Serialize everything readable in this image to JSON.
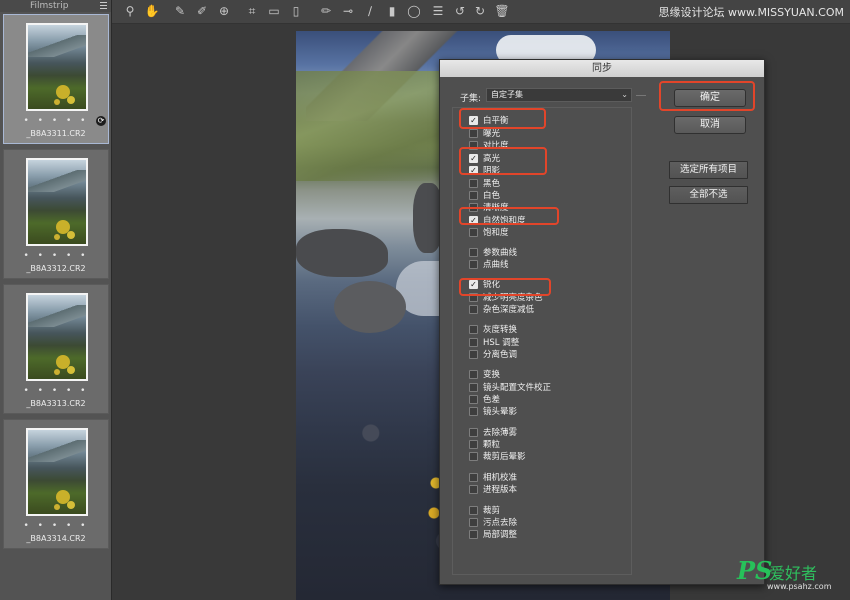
{
  "filmstrip": {
    "title": "Filmstrip",
    "items": [
      {
        "name": "_B8A3311.CR2",
        "rating": "• • • • •"
      },
      {
        "name": "_B8A3312.CR2",
        "rating": "• • • • •"
      },
      {
        "name": "_B8A3313.CR2",
        "rating": "• • • • •"
      },
      {
        "name": "_B8A3314.CR2",
        "rating": "• • • • •"
      }
    ]
  },
  "toolbar": {
    "tools": [
      "zoom-icon",
      "hand-icon",
      "white-balance-icon",
      "color-sampler-icon",
      "target-adjust-icon",
      "crop-icon",
      "straighten-icon",
      "transform-icon",
      "spot-removal-icon",
      "red-eye-icon",
      "adjustment-brush-icon",
      "graduated-filter-icon",
      "radial-filter-icon",
      "preferences-icon",
      "rotate-left-icon",
      "rotate-right-icon",
      "trash-icon"
    ],
    "watermark": "思缘设计论坛 www.MISSYUAN.COM"
  },
  "dialog": {
    "title": "同步",
    "subset_label": "子集:",
    "subset_value": "自定子集",
    "ok_label": "确定",
    "cancel_label": "取消",
    "select_all_label": "选定所有项目",
    "deselect_all_label": "全部不选",
    "options": [
      {
        "label": "白平衡",
        "checked": true
      },
      {
        "label": "曝光",
        "checked": false
      },
      {
        "label": "对比度",
        "checked": false
      },
      {
        "label": "高光",
        "checked": true
      },
      {
        "label": "阴影",
        "checked": true
      },
      {
        "label": "黑色",
        "checked": false
      },
      {
        "label": "白色",
        "checked": false
      },
      {
        "label": "清晰度",
        "checked": false
      },
      {
        "label": "自然饱和度",
        "checked": true
      },
      {
        "label": "饱和度",
        "checked": false
      },
      {
        "label": "参数曲线",
        "checked": false
      },
      {
        "label": "点曲线",
        "checked": false
      },
      {
        "label": "锐化",
        "checked": true
      },
      {
        "label": "减少明亮度杂色",
        "checked": false
      },
      {
        "label": "杂色深度减低",
        "checked": false
      },
      {
        "label": "灰度转换",
        "checked": false
      },
      {
        "label": "HSL 调整",
        "checked": false
      },
      {
        "label": "分离色调",
        "checked": false
      },
      {
        "label": "变换",
        "checked": false
      },
      {
        "label": "镜头配置文件校正",
        "checked": false
      },
      {
        "label": "色差",
        "checked": false
      },
      {
        "label": "镜头晕影",
        "checked": false
      },
      {
        "label": "去除薄雾",
        "checked": false
      },
      {
        "label": "颗粒",
        "checked": false
      },
      {
        "label": "裁剪后晕影",
        "checked": false
      },
      {
        "label": "相机校准",
        "checked": false
      },
      {
        "label": "进程版本",
        "checked": false
      },
      {
        "label": "裁剪",
        "checked": false
      },
      {
        "label": "污点去除",
        "checked": false
      },
      {
        "label": "局部调整",
        "checked": false
      }
    ]
  },
  "watermark_bottom": {
    "ps": "PS",
    "cn": "爱好者",
    "url": "www.psahz.com"
  },
  "colors": {
    "highlight": "#e2452a"
  }
}
